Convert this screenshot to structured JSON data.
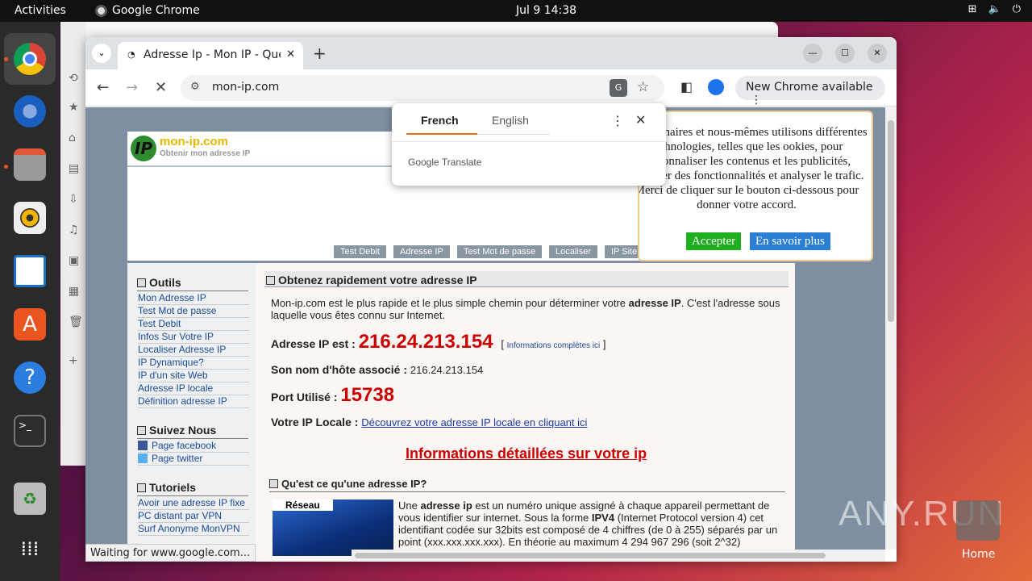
{
  "topbar": {
    "activities": "Activities",
    "app": "Google Chrome",
    "clock": "Jul 9  14:38",
    "tray": [
      "network-icon",
      "volume-icon",
      "power-icon"
    ]
  },
  "dock": {
    "items": [
      "chrome-icon",
      "thunderbird-icon",
      "files-icon",
      "rhythmbox-icon",
      "writer-icon",
      "app-center-icon",
      "help-icon",
      "terminal-icon",
      "trash-icon",
      "apps-grid-icon"
    ]
  },
  "browser": {
    "tab_title": "Adresse Ip - Mon IP - Quel",
    "url": "mon-ip.com",
    "new_chrome": "New Chrome available",
    "status": "Waiting for www.google.com..."
  },
  "translate": {
    "lang_from": "French",
    "lang_to": "English",
    "brand": "Google Translate"
  },
  "site": {
    "logo_name": "mon-ip.com",
    "logo_sub": "Obtenir mon adresse IP",
    "menu": [
      "Test Debit",
      "Adresse IP",
      "Test Mot de passe",
      "Localiser",
      "IP Site"
    ],
    "outils_title": "Outils",
    "outils_links": [
      "Mon Adresse IP",
      "Test Mot de passe",
      "Test Debit",
      "Infos Sur Votre IP",
      "Localiser Adresse IP",
      "IP Dynamique?",
      "IP d'un site Web",
      "Adresse IP locale",
      "Définition adresse IP"
    ],
    "suivez_title": "Suivez Nous",
    "suivez_links": [
      "Page facebook",
      "Page twitter"
    ],
    "tutoriels_title": "Tutoriels",
    "tutoriels_links": [
      "Avoir une adresse IP fixe",
      "PC distant par VPN",
      "Surf Anonyme MonVPN"
    ],
    "main_title": "Obtenez rapidement votre adresse IP",
    "intro_a": "Mon-ip.com est le plus rapide et le plus simple chemin pour déterminer votre ",
    "intro_b": "adresse IP",
    "intro_c": ". C'est l'adresse sous laquelle vous êtes connu sur Internet.",
    "ip_label": "Adresse IP est :",
    "ip_value": "216.24.213.154",
    "ip_info_link": "Informations complètes ici",
    "host_label": "Son nom d'hôte associé :",
    "host_value": "216.24.213.154",
    "port_label": "Port Utilisé :",
    "port_value": "15738",
    "local_label": "Votre IP Locale :",
    "local_link": "Découvrez votre adresse IP locale en cliquant ici",
    "details_link": "Informations détaillées sur votre ip",
    "q_title": "Qu'est ce qu'une adresse IP?",
    "image_label": "Réseau",
    "para_a": "Une ",
    "para_b": "adresse ip",
    "para_c": " est un numéro unique assigné à chaque appareil permettant de vous identifier sur internet. Sous la forme ",
    "para_d": "IPV4",
    "para_e": " (Internet Protocol version 4) cet identifiant codée sur 32bits est composé de 4 chiffres (de 0 à 255) séparés par un point (xxx.xxx.xxx.xxx). En théorie au maximum 4 294 967 296 (soit 2^32)"
  },
  "cookie": {
    "text": "os partenaires et nous-mêmes utilisons différentes technologies, telles que les ookies, pour personnaliser les contenus et les publicités, proposer des fonctionnalités et analyser le trafic. Merci de cliquer sur le bouton ci-dessous pour donner votre accord.",
    "accept": "Accepter",
    "more": "En savoir plus"
  },
  "desktop": {
    "watermark": "ANY.RUN",
    "home_label": "Home"
  }
}
